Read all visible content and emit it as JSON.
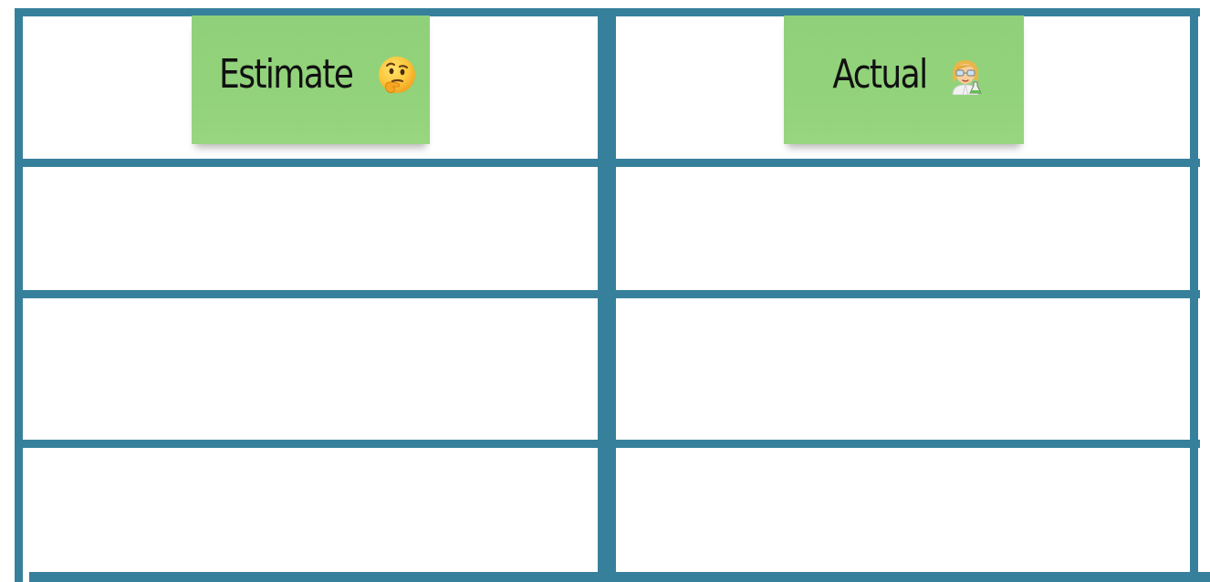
{
  "board": {
    "columns": [
      {
        "header": {
          "label": "Estimate",
          "icon": "thinking-face-icon",
          "note_color": "#93d37b"
        }
      },
      {
        "header": {
          "label": "Actual",
          "icon": "woman-scientist-icon",
          "note_color": "#93d37b"
        }
      }
    ],
    "rows": 4,
    "frame_color": "#36809b"
  }
}
